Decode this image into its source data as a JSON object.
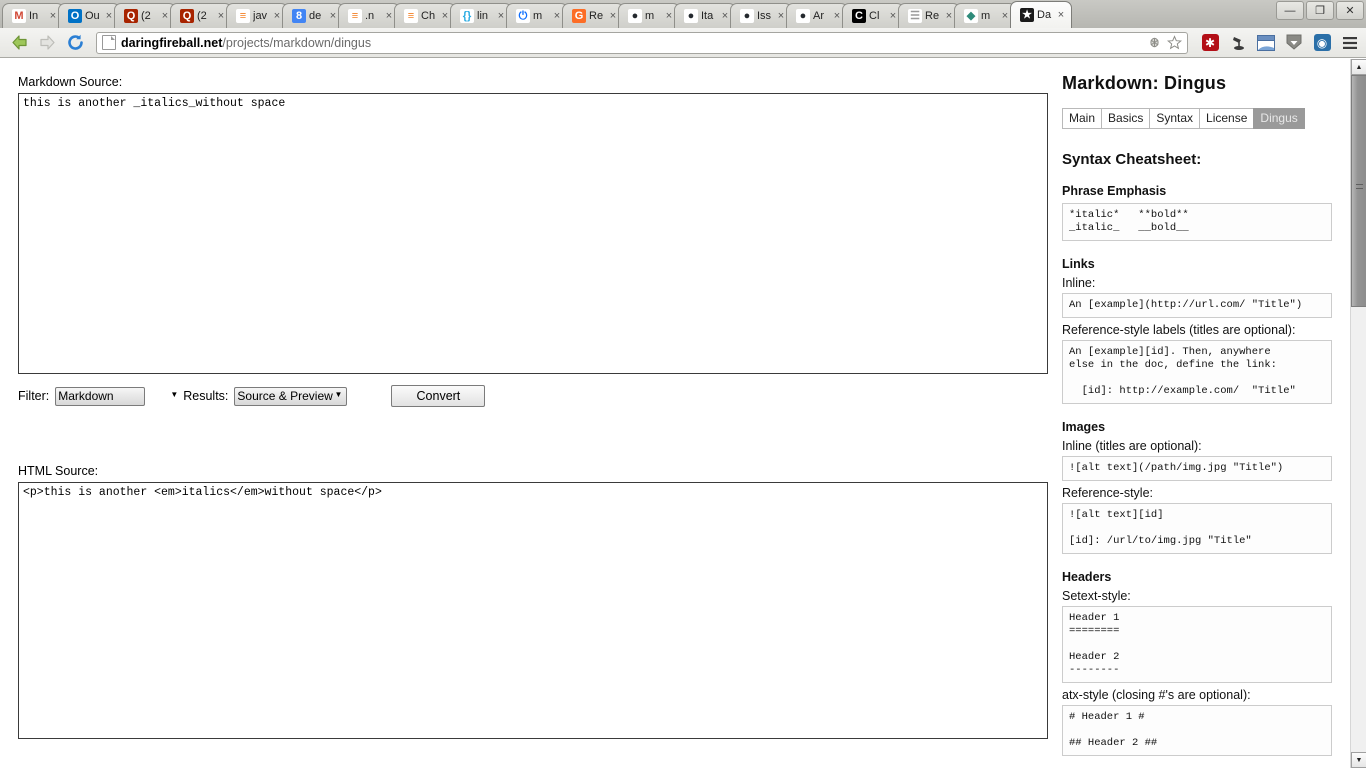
{
  "browser": {
    "tabs": [
      {
        "label": "In",
        "icon": "gmail-icon",
        "icon_glyph": "M",
        "icon_color": "#d14836",
        "icon_bg": "#ffffff",
        "active": false
      },
      {
        "label": "Ou",
        "icon": "outlook-icon",
        "icon_glyph": "O",
        "icon_color": "#ffffff",
        "icon_bg": "#0072c6",
        "active": false
      },
      {
        "label": "(2",
        "icon": "quora-icon",
        "icon_glyph": "Q",
        "icon_color": "#ffffff",
        "icon_bg": "#a82400",
        "active": false
      },
      {
        "label": "(2",
        "icon": "quora-icon",
        "icon_glyph": "Q",
        "icon_color": "#ffffff",
        "icon_bg": "#a82400",
        "active": false
      },
      {
        "label": "jav",
        "icon": "stackoverflow-icon",
        "icon_glyph": "≡",
        "icon_color": "#f48024",
        "icon_bg": "#ffffff",
        "active": false
      },
      {
        "label": "de",
        "icon": "google-icon",
        "icon_glyph": "8",
        "icon_color": "#ffffff",
        "icon_bg": "#4285f4",
        "active": false
      },
      {
        "label": ".n",
        "icon": "stackoverflow-icon",
        "icon_glyph": "≡",
        "icon_color": "#f48024",
        "icon_bg": "#ffffff",
        "active": false
      },
      {
        "label": "Ch",
        "icon": "stackoverflow-icon",
        "icon_glyph": "≡",
        "icon_color": "#f48024",
        "icon_bg": "#ffffff",
        "active": false
      },
      {
        "label": "lin",
        "icon": "json-icon",
        "icon_glyph": "{}",
        "icon_color": "#29abe2",
        "icon_bg": "#ffffff",
        "active": false
      },
      {
        "label": "m",
        "icon": "power-icon",
        "icon_glyph": "⏻",
        "icon_color": "#0d6efd",
        "icon_bg": "#ffffff",
        "active": false
      },
      {
        "label": "Re",
        "icon": "gitlab-icon",
        "icon_glyph": "G",
        "icon_color": "#ffffff",
        "icon_bg": "#fc6d26",
        "active": false
      },
      {
        "label": "m",
        "icon": "github-icon",
        "icon_glyph": "●",
        "icon_color": "#24292e",
        "icon_bg": "#ffffff",
        "active": false
      },
      {
        "label": "Ita",
        "icon": "github-icon",
        "icon_glyph": "●",
        "icon_color": "#24292e",
        "icon_bg": "#ffffff",
        "active": false
      },
      {
        "label": "Iss",
        "icon": "github-icon",
        "icon_glyph": "●",
        "icon_color": "#24292e",
        "icon_bg": "#ffffff",
        "active": false
      },
      {
        "label": "Ar",
        "icon": "github-icon",
        "icon_glyph": "●",
        "icon_color": "#24292e",
        "icon_bg": "#ffffff",
        "active": false
      },
      {
        "label": "Cl",
        "icon": "c-icon",
        "icon_glyph": "C",
        "icon_color": "#ffffff",
        "icon_bg": "#000000",
        "active": false
      },
      {
        "label": "Re",
        "icon": "document-icon",
        "icon_glyph": "☰",
        "icon_color": "#9a9a9a",
        "icon_bg": "#ffffff",
        "active": false
      },
      {
        "label": "m",
        "icon": "shield-icon",
        "icon_glyph": "◆",
        "icon_color": "#2e8b7a",
        "icon_bg": "#ffffff",
        "active": false
      },
      {
        "label": "Da",
        "icon": "star-icon",
        "icon_glyph": "★",
        "icon_color": "#ffffff",
        "icon_bg": "#1a1a1a",
        "active": true
      }
    ],
    "tab_close_glyph": "×",
    "window_controls": [
      {
        "name": "minimize-button",
        "glyph": "—"
      },
      {
        "name": "maximize-button",
        "glyph": "❐"
      },
      {
        "name": "close-button",
        "glyph": "✕"
      }
    ],
    "nav": {
      "back_glyph": "←",
      "forward_glyph": "→",
      "reload_glyph": "↻"
    },
    "url": {
      "host": "daringfireball.net",
      "path": "/projects/markdown/dingus",
      "bug_icon_glyph": "✶",
      "star_icon_glyph": "☆"
    },
    "toolbar_icons": [
      {
        "name": "adblock-icon",
        "glyph": "✱",
        "color": "#ffffff",
        "bg": "#b30f17"
      },
      {
        "name": "lamp-icon",
        "glyph": "☥",
        "color": "#3a3a3a",
        "bg": "transparent"
      },
      {
        "name": "window-icon",
        "glyph": "◰",
        "color": "#3b5c8f",
        "bg": "transparent"
      },
      {
        "name": "download-icon",
        "glyph": "▼",
        "color": "#ffffff",
        "bg": "#777777"
      },
      {
        "name": "sync-icon",
        "glyph": "◌",
        "color": "#ffffff",
        "bg": "#2a6fa8"
      },
      {
        "name": "menu-icon",
        "glyph": "≡",
        "color": "#333333",
        "bg": "transparent"
      }
    ]
  },
  "main": {
    "markdown_source_label": "Markdown Source:",
    "markdown_source_value": "this is another _italics_without space",
    "markdown_source_placeholder": "",
    "controls": {
      "filter_label": "Filter:",
      "filter_value": "Markdown",
      "filter_options": [
        "Markdown"
      ],
      "results_label": "Results:",
      "results_value": "Source & Preview",
      "results_options": [
        "Source & Preview"
      ],
      "convert_label": "Convert"
    },
    "html_source_label": "HTML Source:",
    "html_source_value": "<p>this is another <em>italics</em>without space</p>"
  },
  "sidebar": {
    "title": "Markdown: Dingus",
    "nav": [
      {
        "label": "Main",
        "current": false
      },
      {
        "label": "Basics",
        "current": false
      },
      {
        "label": "Syntax",
        "current": false
      },
      {
        "label": "License",
        "current": false
      },
      {
        "label": "Dingus",
        "current": true
      }
    ],
    "cheatsheet_title": "Syntax Cheatsheet:",
    "sections": [
      {
        "heading": "Phrase Emphasis",
        "blocks": [
          {
            "caption": "",
            "code": "*italic*   **bold**\n_italic_   __bold__"
          }
        ]
      },
      {
        "heading": "Links",
        "blocks": [
          {
            "caption": "Inline:",
            "code": "An [example](http://url.com/ \"Title\")"
          },
          {
            "caption": "Reference-style labels (titles are optional):",
            "code": "An [example][id]. Then, anywhere\nelse in the doc, define the link:\n\n  [id]: http://example.com/  \"Title\""
          }
        ]
      },
      {
        "heading": "Images",
        "blocks": [
          {
            "caption": "Inline (titles are optional):",
            "code": "![alt text](/path/img.jpg \"Title\")"
          },
          {
            "caption": "Reference-style:",
            "code": "![alt text][id]\n\n[id]: /url/to/img.jpg \"Title\""
          }
        ]
      },
      {
        "heading": "Headers",
        "blocks": [
          {
            "caption": "Setext-style:",
            "code": "Header 1\n========\n\nHeader 2\n--------"
          },
          {
            "caption": "atx-style (closing #'s are optional):",
            "code": "# Header 1 #\n\n## Header 2 ##"
          }
        ]
      }
    ]
  },
  "scrollbar": {
    "up_glyph": "▲",
    "down_glyph": "▼"
  },
  "colors": {
    "page_bg": "#ffffff",
    "chrome_bg": "#e6e6e2",
    "active_tab_bg": "#fdfdfd",
    "nav_current_bg": "#9a9a9a",
    "codebox_border": "#cccccc"
  }
}
